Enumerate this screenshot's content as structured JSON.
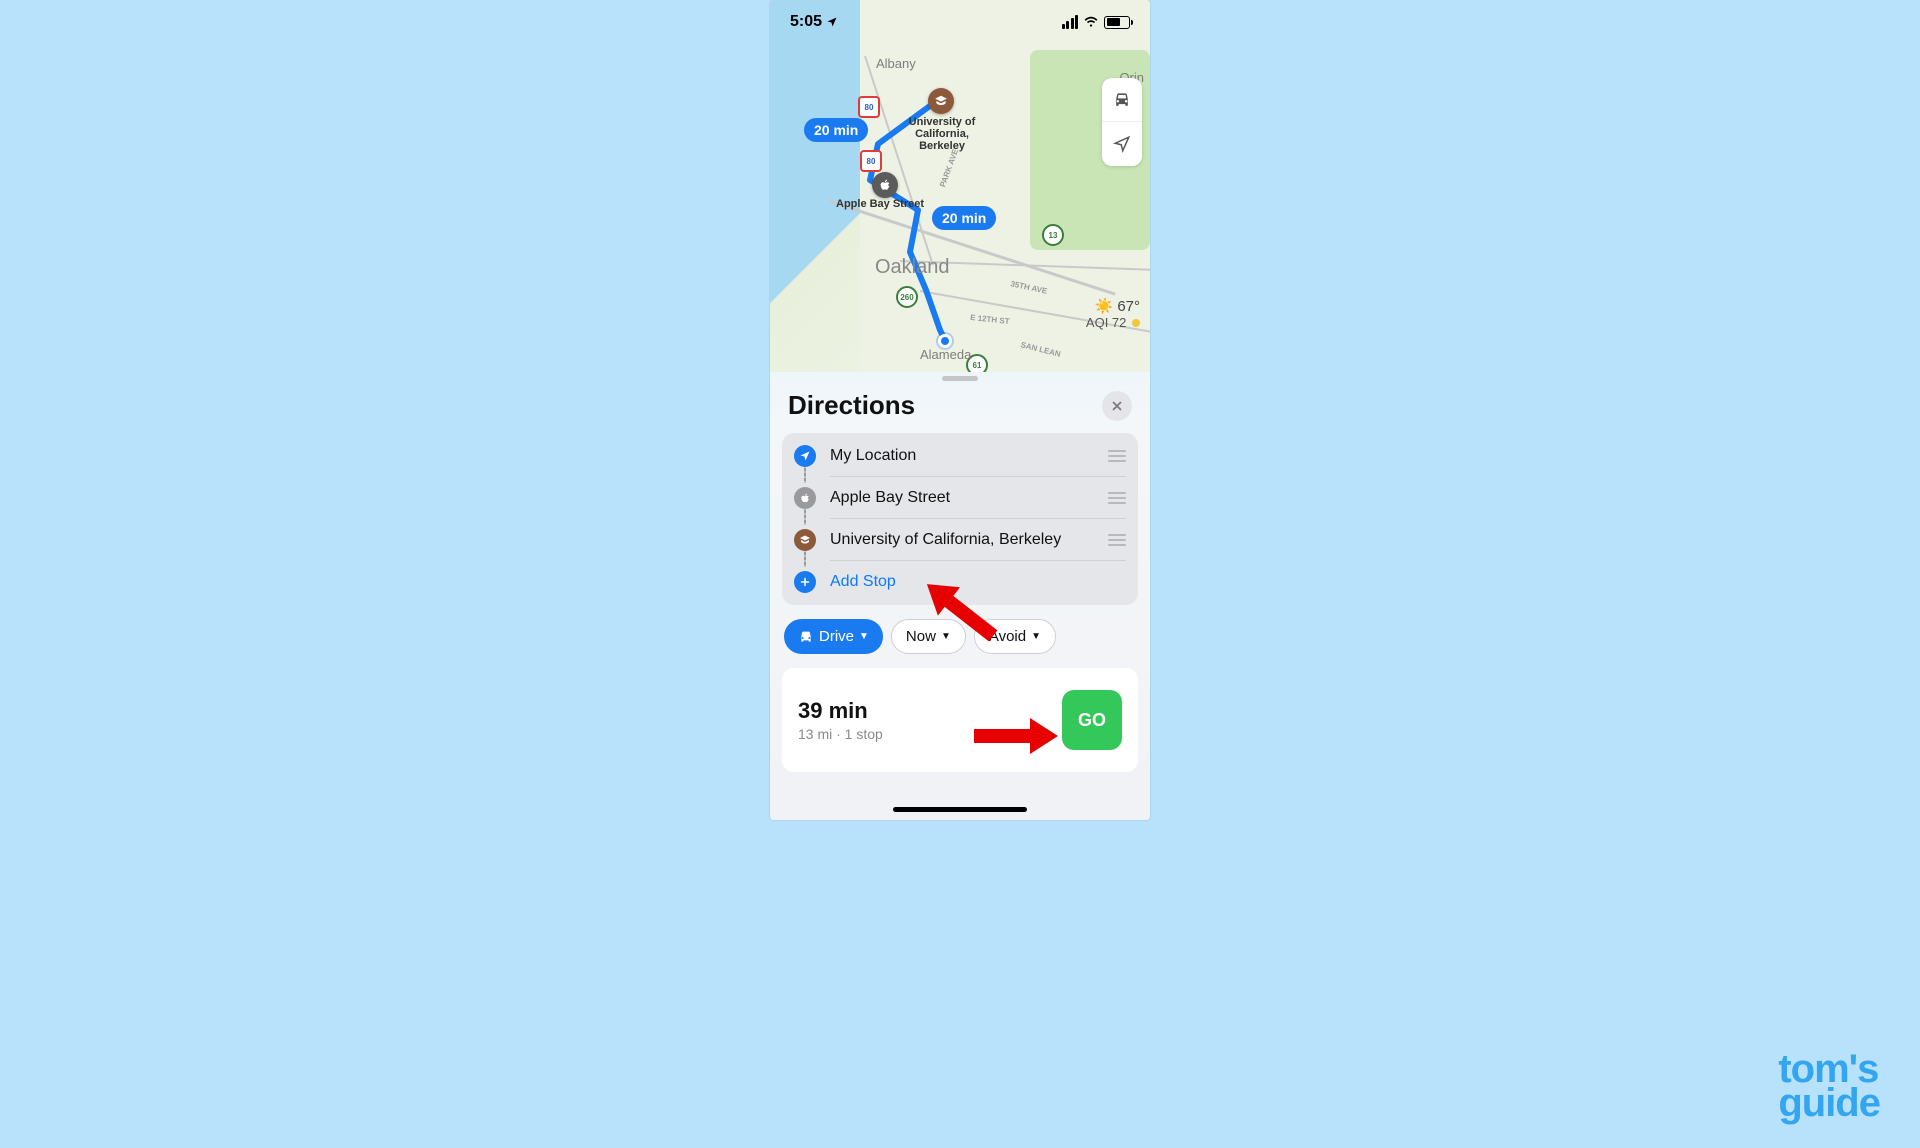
{
  "statusbar": {
    "time": "5:05",
    "location_services": true
  },
  "map": {
    "cities": {
      "albany": "Albany",
      "oakland": "Oakland",
      "alameda": "Alameda",
      "orinda": "Orin"
    },
    "route_times": [
      "20 min",
      "20 min"
    ],
    "pins": {
      "ucberkeley": "University of\nCalifornia,\nBerkeley",
      "applebay": "Apple Bay Street"
    },
    "highway_shields": [
      "80",
      "80",
      "260",
      "13",
      "61"
    ],
    "street_labels": [
      "PARK AVE",
      "35TH AVE",
      "E 12TH ST",
      "SAN LEAN"
    ],
    "weather": {
      "temp": "67°",
      "aqi": "AQI 72"
    }
  },
  "panel": {
    "title": "Directions",
    "stops": [
      {
        "label": "My Location",
        "icon": "location"
      },
      {
        "label": "Apple Bay Street",
        "icon": "apple"
      },
      {
        "label": "University of California, Berkeley",
        "icon": "education"
      }
    ],
    "add_stop": "Add Stop",
    "modes": {
      "drive": "Drive",
      "now": "Now",
      "avoid": "Avoid"
    },
    "result": {
      "duration": "39 min",
      "detail": "13 mi · 1 stop",
      "go": "GO"
    }
  },
  "watermark": {
    "line1": "tom's",
    "line2": "guide"
  }
}
